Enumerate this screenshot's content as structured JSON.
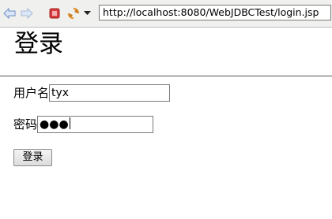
{
  "browser": {
    "url": "http://localhost:8080/WebJDBCTest/login.jsp",
    "toolbar_icons": [
      "back-arrow-icon",
      "forward-arrow-icon",
      "stop-icon",
      "refresh-icon",
      "dropdown-icon"
    ]
  },
  "page": {
    "title": "登录",
    "username_label": "用户名",
    "username_value": "tyx",
    "password_label": "密码",
    "password_mask": "●●●",
    "submit_label": "登录"
  },
  "colors": {
    "stop_red": "#d83c3c",
    "arrow_blue": "#6f8ec7",
    "refresh_orange": "#e79a35"
  }
}
